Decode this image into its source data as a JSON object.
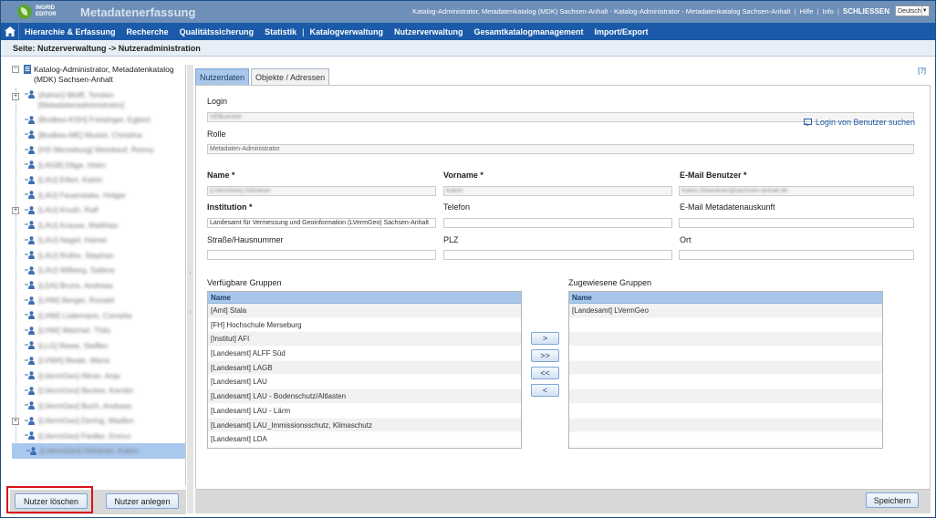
{
  "app": {
    "logo_line1": "INGRID",
    "logo_line2": "EDITOR",
    "title": "Metadatenerfassung",
    "user_info": "Katalog-Administrator, Metadatenkatalog (MDK) Sachsen-Anhalt - Katalog-Administrator - Metadatenkatalog Sachsen-Anhalt",
    "help_label": "Hilfe",
    "info_label": "Info",
    "close_label": "SCHLIESSEN",
    "language": "Deutsch"
  },
  "nav": {
    "items": [
      "Hierarchie & Erfassung",
      "Recherche",
      "Qualitätssicherung",
      "Statistik",
      "Katalogverwaltung",
      "Nutzerverwaltung",
      "Gesamtkatalogmanagement",
      "Import/Export"
    ],
    "separator": "|"
  },
  "breadcrumb": "Seite: Nutzerverwaltung -> Nutzeradministration",
  "tree": {
    "root_label": "Katalog-Administrator, Metadatenkatalog (MDK) Sachsen-Anhalt",
    "items": [
      {
        "label": "[Admin] Wolff, Torsten [Metadatenadministrator]",
        "expandable": true
      },
      {
        "label": "[Bodkes-KSH] Freisinger, Egbert",
        "expandable": false
      },
      {
        "label": "[Bodkes-ME] Musiol, Christina",
        "expandable": false
      },
      {
        "label": "[HS Merseburg] Weinkauf, Ronny",
        "expandable": false
      },
      {
        "label": "[LAGB] Dilge, Holm",
        "expandable": false
      },
      {
        "label": "[LAU] Eifert, Katrin",
        "expandable": false
      },
      {
        "label": "[LAU] Feuerstake, Holger",
        "expandable": false
      },
      {
        "label": "[LAU] Knuth, Ralf",
        "expandable": true
      },
      {
        "label": "[LAU] Krause, Matthias",
        "expandable": false
      },
      {
        "label": "[LAU] Nagel, Heiner",
        "expandable": false
      },
      {
        "label": "[LAU] Rothe, Stephan",
        "expandable": false
      },
      {
        "label": "[LAU] Wilberg, Sabine",
        "expandable": false
      },
      {
        "label": "[LDA] Bruns, Andreas",
        "expandable": false
      },
      {
        "label": "[LHW] Berger, Ronald",
        "expandable": false
      },
      {
        "label": "[LHW] Lüdemann, Cornelia",
        "expandable": false
      },
      {
        "label": "[LHW] Weichel, Thilo",
        "expandable": false
      },
      {
        "label": "[LLG] Rewe, Steffen",
        "expandable": false
      },
      {
        "label": "[LVWA] Beale, Maria",
        "expandable": false
      },
      {
        "label": "[LVermGeo] Altner, Anja",
        "expandable": false
      },
      {
        "label": "[LVermGeo] Becker, Kerstin",
        "expandable": false
      },
      {
        "label": "[LVermGeo] Buch, Andreas",
        "expandable": false
      },
      {
        "label": "[LVermGeo] Dering, Madlen",
        "expandable": true
      },
      {
        "label": "[LVermGeo] Fiedler, Enrico",
        "expandable": false
      },
      {
        "label": "[LVermGeo] Glöckner, Katrin",
        "expandable": false,
        "selected": true
      }
    ]
  },
  "left_buttons": {
    "delete": "Nutzer löschen",
    "create": "Nutzer anlegen"
  },
  "tabs": [
    "Nutzerdaten",
    "Objekte / Adressen"
  ],
  "help_link": "[?]",
  "form": {
    "login_label": "Login",
    "login_value": "VEBuecker",
    "search_login": "Login von Benutzer suchen",
    "role_label": "Rolle",
    "role_value": "Metadaten-Administrator",
    "name_label": "Name *",
    "name_value": "[LVermGeo] Glöckner",
    "firstname_label": "Vorname *",
    "firstname_value": "Katrin",
    "email_label": "E-Mail Benutzer *",
    "email_value": "Katrin.Gloeckner@sachsen-anhalt.de",
    "institution_label": "Institution *",
    "institution_value": "Landesamt für Vermessung und Geoinformation (LVermGeo) Sachsen-Anhalt",
    "phone_label": "Telefon",
    "phone_value": "",
    "meta_email_label": "E-Mail Metadatenauskunft",
    "meta_email_value": "",
    "street_label": "Straße/Hausnummer",
    "street_value": "",
    "zip_label": "PLZ",
    "zip_value": "",
    "city_label": "Ort",
    "city_value": ""
  },
  "groups": {
    "available_label": "Verfügbare Gruppen",
    "assigned_label": "Zugewiesene Gruppen",
    "column_name": "Name",
    "available": [
      "[Amt] Stala",
      "[FH] Hochschule Merseburg",
      "[Institut] AFI",
      "[Landesamt] ALFF Süd",
      "[Landesamt] LAGB",
      "[Landesamt] LAU",
      "[Landesamt] LAU - Bodenschutz/Altlasten",
      "[Landesamt] LAU - Lärm",
      "[Landesamt] LAU_Immissionsschutz, Klimaschutz",
      "[Landesamt] LDA"
    ],
    "assigned": [
      "[Landesamt] LVermGeo"
    ],
    "move_buttons": [
      ">",
      ">>",
      "<<",
      "<"
    ]
  },
  "save_label": "Speichern"
}
